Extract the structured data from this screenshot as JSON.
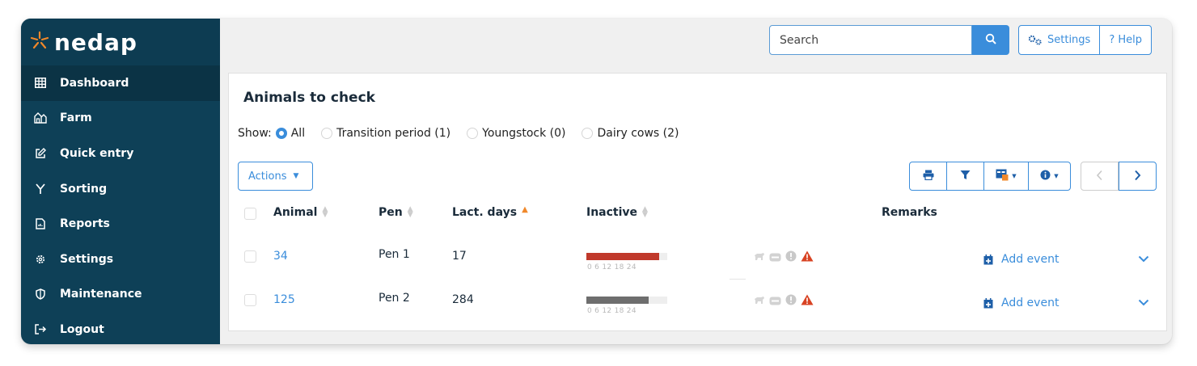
{
  "brand": {
    "name": "nedap",
    "accent": "#f0882a",
    "sidebar_color": "#0e4057"
  },
  "sidebar": {
    "items": [
      {
        "label": "Dashboard",
        "icon": "table-icon"
      },
      {
        "label": "Farm",
        "icon": "farm-icon"
      },
      {
        "label": "Quick entry",
        "icon": "edit-icon"
      },
      {
        "label": "Sorting",
        "icon": "sorting-icon"
      },
      {
        "label": "Reports",
        "icon": "report-icon"
      },
      {
        "label": "Settings",
        "icon": "gear-icon"
      },
      {
        "label": "Maintenance",
        "icon": "shield-icon"
      },
      {
        "label": "Logout",
        "icon": "logout-icon"
      }
    ],
    "active": "Dashboard"
  },
  "topbar": {
    "search_placeholder": "Search",
    "settings_label": "Settings",
    "help_label": "? Help"
  },
  "panel": {
    "title": "Animals to check",
    "show_label": "Show:",
    "filters": [
      {
        "label": "All",
        "selected": true
      },
      {
        "label": "Transition period (1)",
        "selected": false
      },
      {
        "label": "Youngstock (0)",
        "selected": false
      },
      {
        "label": "Dairy cows (2)",
        "selected": false
      }
    ],
    "actions_label": "Actions",
    "columns": [
      "Animal",
      "Pen",
      "Lact. days",
      "Inactive",
      "Remarks"
    ],
    "sorted_column": "Lact. days",
    "bar_ticks": "0   6   12   18  24",
    "rows": [
      {
        "animal": "34",
        "pen": "Pen 1",
        "lact_days": "17",
        "inactive_hours": 21.5,
        "bar_color": "#c0392b",
        "action": "Add event"
      },
      {
        "animal": "125",
        "pen": "Pen 2",
        "lact_days": "284",
        "inactive_hours": 18.5,
        "bar_color": "#6e6e6e",
        "action": "Add event"
      }
    ]
  }
}
